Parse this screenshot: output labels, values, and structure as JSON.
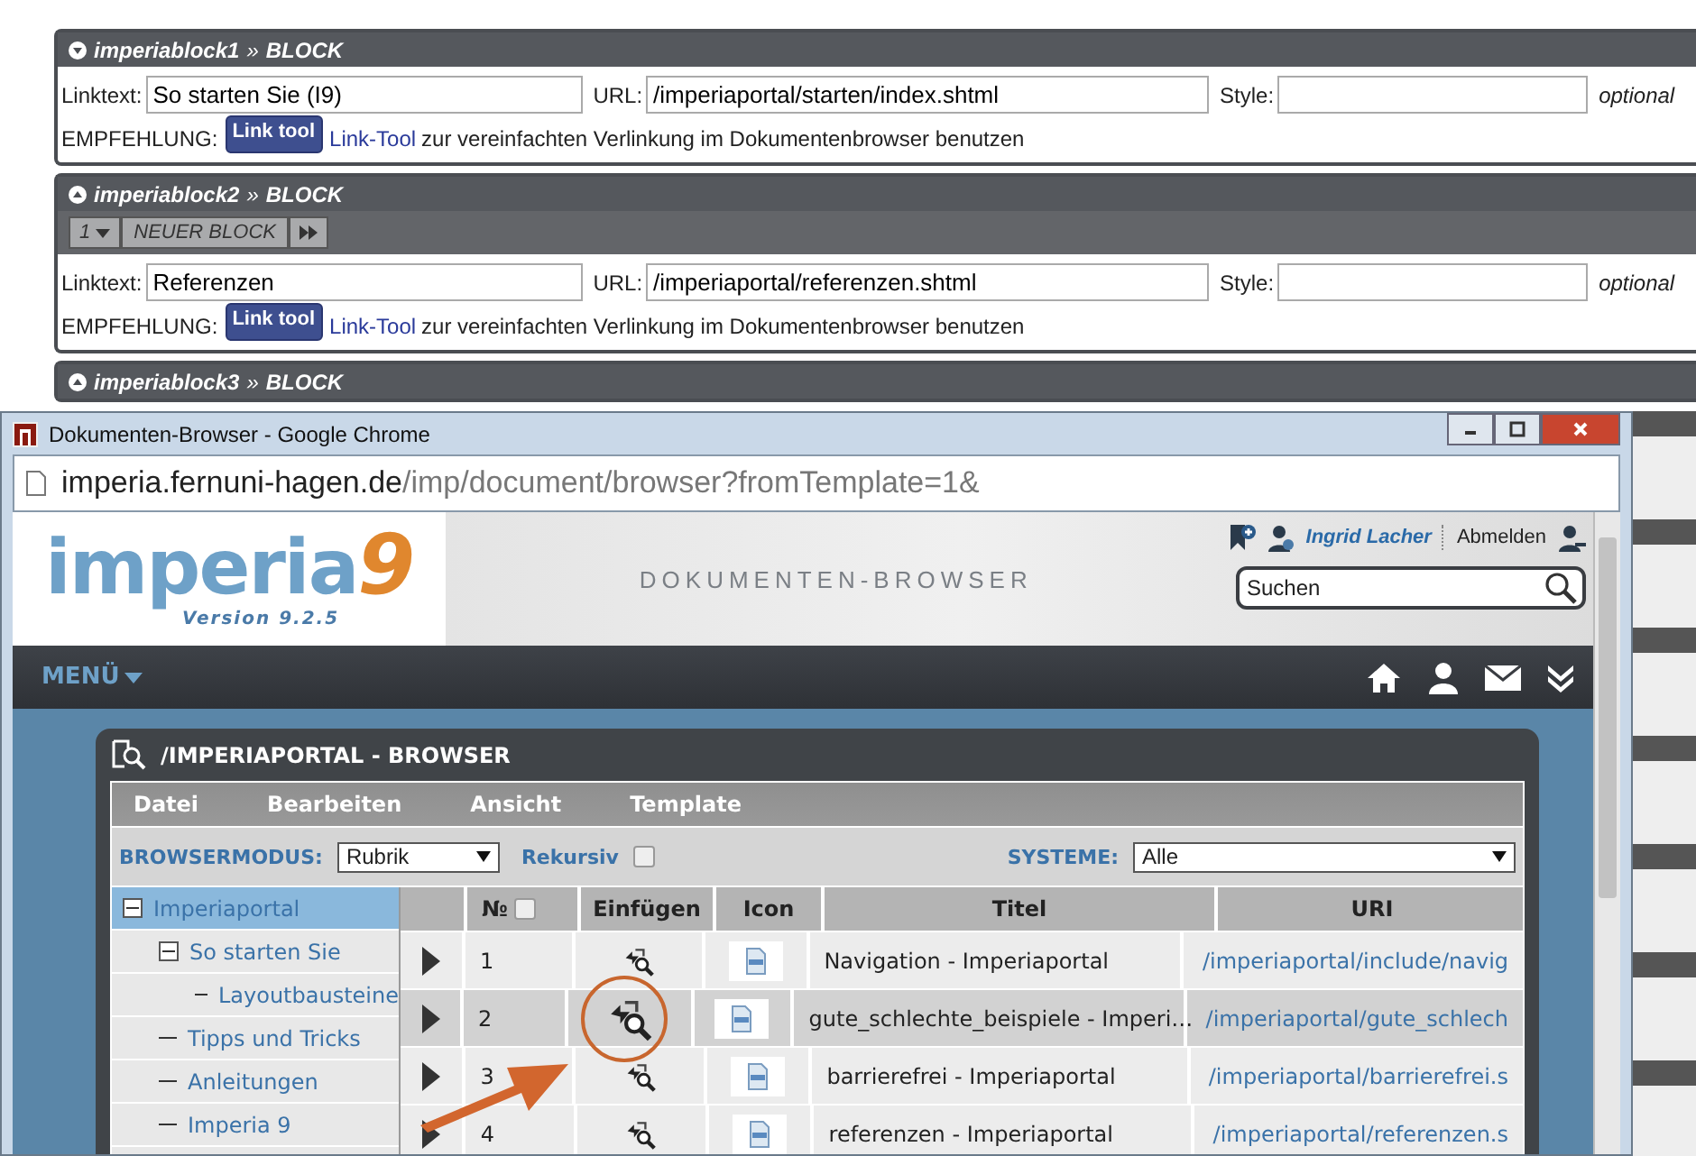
{
  "blocks": [
    {
      "title": "imperiablock1",
      "separator": "»",
      "type": "BLOCK",
      "expanded": true,
      "linktext_label": "Linktext:",
      "linktext": "So starten Sie (I9)",
      "url_label": "URL:",
      "url": "/imperiaportal/starten/index.shtml",
      "style_label": "Style:",
      "optional": "optional",
      "hint_label": "EMPFEHLUNG:",
      "hint_button": "Link tool",
      "hint_link": "Link-Tool",
      "hint_text": "zur vereinfachten Verlinkung im Dokumentenbrowser benutzen"
    },
    {
      "title": "imperiablock2",
      "separator": "»",
      "type": "BLOCK",
      "expanded": false,
      "pager": {
        "count": "1",
        "action": "NEUER BLOCK"
      },
      "linktext_label": "Linktext:",
      "linktext": "Referenzen",
      "url_label": "URL:",
      "url": "/imperiaportal/referenzen.shtml",
      "style_label": "Style:",
      "optional": "optional",
      "hint_label": "EMPFEHLUNG:",
      "hint_button": "Link tool",
      "hint_link": "Link-Tool",
      "hint_text": "zur vereinfachten Verlinkung im Dokumentenbrowser benutzen"
    },
    {
      "title": "imperiablock3",
      "separator": "»",
      "type": "BLOCK",
      "expanded": false
    }
  ],
  "window": {
    "title": "Dokumenten-Browser - Google Chrome",
    "address_host": "imperia.fernuni-hagen.de",
    "address_path": "/imp/document/browser?fromTemplate=1&"
  },
  "header": {
    "logo": "imperia",
    "logo_number": "9",
    "version": "Version 9.2.5",
    "page_title": "DOKUMENTEN-BROWSER",
    "user": "Ingrid Lacher",
    "logout": "Abmelden",
    "search": {
      "placeholder": "Suchen"
    }
  },
  "nav": {
    "menu": "MENÜ"
  },
  "browser": {
    "title": "/IMPERIAPORTAL - BROWSER",
    "menu": [
      "Datei",
      "Bearbeiten",
      "Ansicht",
      "Template"
    ],
    "mode_label": "BROWSERMODUS:",
    "mode_value": "Rubrik",
    "recursive_label": "Rekursiv",
    "recursive": false,
    "systems_label": "SYSTEME:",
    "systems_value": "Alle",
    "tree": [
      {
        "label": "Imperiaportal",
        "selected": true,
        "expanded": true,
        "children": [
          {
            "label": "So starten Sie",
            "selected": false,
            "expanded": true,
            "children": [
              {
                "label": "Layoutbausteine",
                "selected": false
              }
            ]
          },
          {
            "label": "Tipps und Tricks",
            "selected": false
          },
          {
            "label": "Anleitungen",
            "selected": false
          },
          {
            "label": "Imperia 9",
            "selected": false
          }
        ]
      }
    ],
    "columns": [
      "№",
      "Einfügen",
      "Icon",
      "Titel",
      "URI"
    ],
    "all_selected": false,
    "rows": [
      {
        "no": "1",
        "title": "Navigation - Imperiaportal",
        "uri": "/imperiaportal/include/navig",
        "selected": false,
        "highlighted": false
      },
      {
        "no": "2",
        "title": "gute_schlechte_beispiele - Imperi…",
        "uri": "/imperiaportal/gute_schlech",
        "selected": true,
        "highlighted": true
      },
      {
        "no": "3",
        "title": "barrierefrei - Imperiaportal",
        "uri": "/imperiaportal/barrierefrei.s",
        "selected": false,
        "highlighted": false
      },
      {
        "no": "4",
        "title": "referenzen - Imperiaportal",
        "uri": "/imperiaportal/referenzen.s",
        "selected": false,
        "highlighted": false
      }
    ]
  }
}
